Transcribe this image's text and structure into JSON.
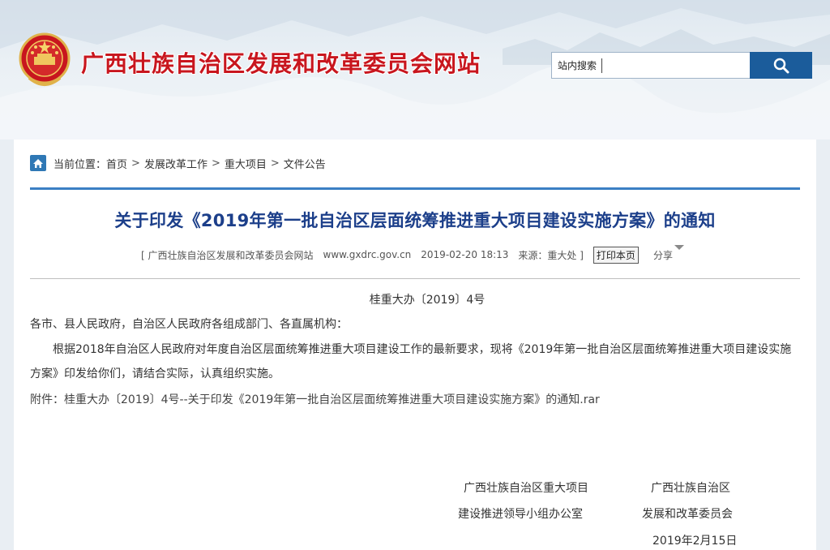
{
  "site": {
    "title": "广西壮族自治区发展和改革委员会网站",
    "emblem_icon": "national-emblem",
    "brand_color": "#c8161e"
  },
  "search": {
    "label": "站内搜索",
    "value": "",
    "button_icon": "search-icon"
  },
  "breadcrumb": {
    "prefix": "当前位置：",
    "items": [
      "首页",
      "发展改革工作",
      "重大项目",
      "文件公告"
    ],
    "separator": ">"
  },
  "article": {
    "title": "关于印发《2019年第一批自治区层面统筹推进重大项目建设实施方案》的通知",
    "meta": {
      "source_site": "[ 广西壮族自治区发展和改革委员会网站",
      "url": "www.gxdrc.gov.cn",
      "datetime": "2019-02-20 18:13",
      "source": "来源：重大处 ]",
      "print_label": "打印本页",
      "share_label": "分享"
    },
    "doc_number": "桂重大办〔2019〕4号",
    "salutation": "各市、县人民政府，自治区人民政府各组成部门、各直属机构：",
    "paragraph": "根据2018年自治区人民政府对年度自治区层面统筹推进重大项目建设工作的最新要求，现将《2019年第一批自治区层面统筹推进重大项目建设实施方案》印发给你们，请结合实际，认真组织实施。",
    "attachment_prefix": "附件：",
    "attachment_link": "桂重大办〔2019〕4号--关于印发《2019年第一批自治区层面统筹推进重大项目建设实施方案》的通知.rar",
    "signature_left": [
      "广西壮族自治区重大项目",
      "建设推进领导小组办公室"
    ],
    "signature_right": [
      "广西壮族自治区",
      "发展和改革委员会"
    ],
    "date": "2019年2月15日"
  },
  "colors": {
    "title_blue": "#1c3f8a",
    "rule_blue": "#3b7fc4",
    "search_button": "#1b5c9b"
  }
}
